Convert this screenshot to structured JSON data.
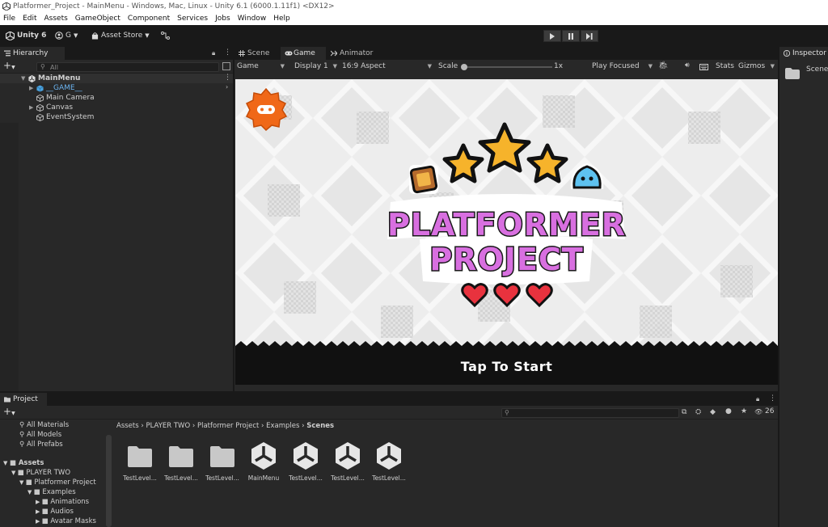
{
  "window": {
    "title": "Platformer_Project - MainMenu - Windows, Mac, Linux - Unity 6.1 (6000.1.11f1) <DX12>"
  },
  "menu": [
    "File",
    "Edit",
    "Assets",
    "GameObject",
    "Component",
    "Services",
    "Jobs",
    "Window",
    "Help"
  ],
  "toolbar": {
    "unity_label": "Unity 6",
    "account_label": "G",
    "asset_store_label": "Asset Store"
  },
  "hierarchy": {
    "tab_label": "Hierarchy",
    "search_placeholder": "All",
    "scene": "MainMenu",
    "items": [
      "__GAME__",
      "Main Camera",
      "Canvas",
      "EventSystem"
    ]
  },
  "center_tabs": [
    "Scene",
    "Game",
    "Animator"
  ],
  "game_bar": {
    "mode": "Game",
    "display": "Display 1",
    "aspect": "16:9 Aspect",
    "scale_label": "Scale",
    "scale_value": "1x",
    "play_mode": "Play Focused",
    "stats": "Stats",
    "gizmos": "Gizmos"
  },
  "game": {
    "logo_line1": "PLATFORMER",
    "logo_line2": "PROJECT",
    "tap_to_start": "Tap To Start"
  },
  "inspector": {
    "tab_label": "Inspector",
    "content": "Scene"
  },
  "project": {
    "tab_label": "Project",
    "search_count": "26",
    "breadcrumb": [
      "Assets",
      "PLAYER TWO",
      "Platformer Project",
      "Examples",
      "Scenes"
    ],
    "favorites": [
      "All Materials",
      "All Models",
      "All Prefabs"
    ],
    "tree": [
      {
        "label": "Assets"
      },
      {
        "label": "PLAYER TWO"
      },
      {
        "label": "Platformer Project"
      },
      {
        "label": "Examples"
      },
      {
        "label": "Animations"
      },
      {
        "label": "Audios"
      },
      {
        "label": "Avatar Masks"
      }
    ],
    "assets": [
      {
        "name": "TestLevel...",
        "kind": "folder"
      },
      {
        "name": "TestLevel...",
        "kind": "folder"
      },
      {
        "name": "TestLevel...",
        "kind": "folder"
      },
      {
        "name": "MainMenu",
        "kind": "scene"
      },
      {
        "name": "TestLevel...",
        "kind": "scene"
      },
      {
        "name": "TestLevel...",
        "kind": "scene"
      },
      {
        "name": "TestLevel...",
        "kind": "scene"
      }
    ]
  }
}
